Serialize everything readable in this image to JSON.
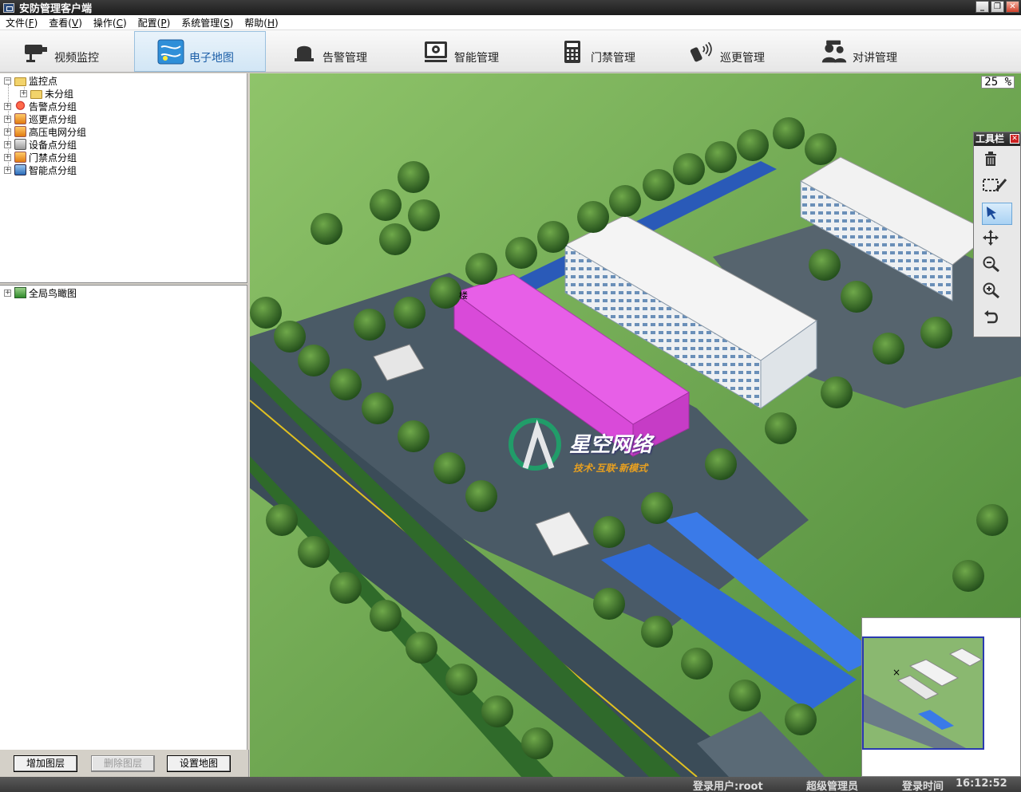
{
  "window": {
    "title": "安防管理客户端",
    "controls": {
      "minimize": "_",
      "restore": "❐",
      "close": "✕"
    }
  },
  "menu": [
    {
      "label": "文件(",
      "key": "F",
      "end": ")"
    },
    {
      "label": "查看(",
      "key": "V",
      "end": ")"
    },
    {
      "label": "操作(",
      "key": "C",
      "end": ")"
    },
    {
      "label": "配置(",
      "key": "P",
      "end": ")"
    },
    {
      "label": "系统管理(",
      "key": "S",
      "end": ")"
    },
    {
      "label": "帮助(",
      "key": "H",
      "end": ")"
    }
  ],
  "modules": [
    {
      "label": "视频监控",
      "icon": "camera-icon"
    },
    {
      "label": "电子地图",
      "icon": "map-icon",
      "active": true
    },
    {
      "label": "告警管理",
      "icon": "alarm-bell-icon"
    },
    {
      "label": "智能管理",
      "icon": "smart-monitor-icon"
    },
    {
      "label": "门禁管理",
      "icon": "access-keypad-icon"
    },
    {
      "label": "巡更管理",
      "icon": "patrol-device-icon"
    },
    {
      "label": "对讲管理",
      "icon": "intercom-icon"
    }
  ],
  "tree_top": {
    "root": "监控点",
    "children": [
      "未分组"
    ],
    "groups": [
      "告警点分组",
      "巡更点分组",
      "高压电网分组",
      "设备点分组",
      "门禁点分组",
      "智能点分组"
    ]
  },
  "tree_bottom": {
    "root": "全局鸟瞰图"
  },
  "buttons": {
    "add_layer": "增加图层",
    "delete_layer": "删除图层",
    "set_map": "设置地图"
  },
  "map": {
    "zoom": "25 %",
    "building_label": "楼",
    "watermark_title": "星空网络",
    "watermark_sub": "技术·互联·新模式"
  },
  "toolbar_panel": {
    "title": "工具栏",
    "tools": [
      "trash-icon",
      "select-rect-draw-icon",
      "pointer-icon",
      "move-icon",
      "zoom-out-icon",
      "zoom-in-icon",
      "undo-icon"
    ],
    "active_tool": "pointer-icon"
  },
  "status": {
    "user_label": "登录用户:root",
    "role": "超级管理员",
    "time_label": "登录时间",
    "time": "16:12:52"
  }
}
